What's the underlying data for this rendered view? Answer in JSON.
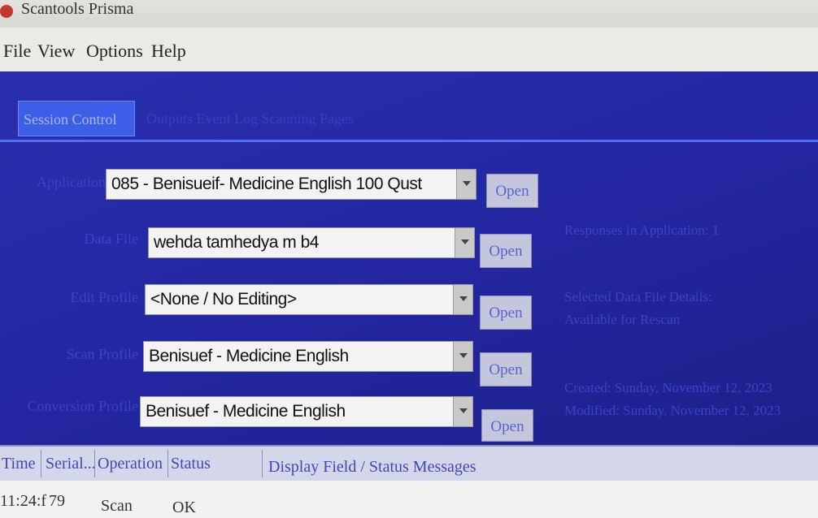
{
  "window": {
    "title": "Scantools Prisma"
  },
  "menu": [
    "File",
    "View",
    "Options",
    "Help"
  ],
  "tabs": {
    "active": "Session Control",
    "others": "Outputs   Event Log   Scanning Pages"
  },
  "fields": [
    {
      "label": "Application",
      "value": "085 - Benisueif- Medicine English 100 Qust",
      "button": "Open"
    },
    {
      "label": "Data File",
      "value": "wehda tamhedya m b4",
      "button": "Open"
    },
    {
      "label": "Edit Profile",
      "value": "<None / No Editing>",
      "button": "Open"
    },
    {
      "label": "Scan Profile",
      "value": "Benisuef - Medicine English",
      "button": "Open"
    },
    {
      "label": "Conversion Profile",
      "value": "Benisuef - Medicine English",
      "button": "Open"
    }
  ],
  "info": {
    "responses": "Responses in Application: 1",
    "selected": "Selected Data File Details:",
    "available": "Available for Rescan",
    "created": "Created: Sunday, November 12, 2023",
    "modified": "Modified: Sunday, November 12, 2023"
  },
  "grid": {
    "columns": [
      "Time",
      "Serial...",
      "Operation",
      "Status",
      "Display Field / Status Messages"
    ],
    "rows": [
      {
        "time": "11:24:f",
        "serial": "79",
        "operation": "Scan",
        "status": "OK"
      }
    ]
  },
  "colors": {
    "accent": "#3d5ee6",
    "background": "#2326a0"
  }
}
